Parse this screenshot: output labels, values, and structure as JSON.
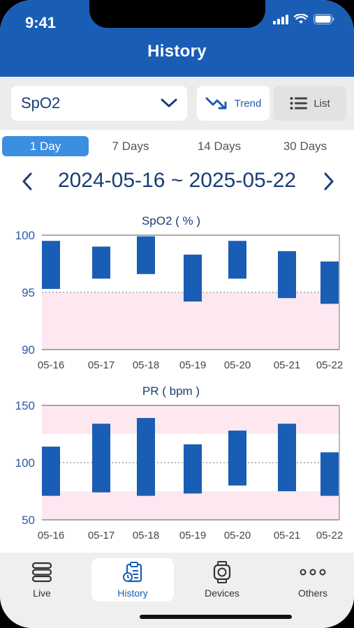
{
  "status": {
    "time": "9:41"
  },
  "header": {
    "title": "History"
  },
  "controls": {
    "metric_select": {
      "value": "SpO2"
    },
    "trend_label": "Trend",
    "list_label": "List"
  },
  "range_tabs": [
    {
      "label": "1 Day",
      "active": true
    },
    {
      "label": "7 Days",
      "active": false
    },
    {
      "label": "14 Days",
      "active": false
    },
    {
      "label": "30 Days",
      "active": false
    }
  ],
  "date_range": "2024-05-16 ~ 2025-05-22",
  "chart_data": [
    {
      "type": "bar",
      "title": "SpO2 ( % )",
      "categories": [
        "05-16",
        "05-17",
        "05-18",
        "05-19",
        "05-20",
        "05-21",
        "05-22"
      ],
      "series": [
        {
          "low": [
            95.3,
            96.2,
            96.6,
            94.2,
            96.2,
            94.5,
            94.0
          ],
          "high": [
            99.5,
            99.0,
            99.9,
            98.3,
            99.5,
            98.6,
            97.7
          ]
        }
      ],
      "ylim": [
        90,
        100
      ],
      "yticks": [
        90,
        95,
        100
      ],
      "normal_band": [
        90,
        95
      ],
      "reference_line": 95,
      "colors": {
        "bar": "#1a5db5",
        "band": "#fde8f1",
        "text": "#1a3c78"
      }
    },
    {
      "type": "bar",
      "title": "PR ( bpm )",
      "categories": [
        "05-16",
        "05-17",
        "05-18",
        "05-19",
        "05-20",
        "05-21",
        "05-22"
      ],
      "series": [
        {
          "low": [
            71,
            74,
            71,
            73,
            80,
            75,
            71
          ],
          "high": [
            114,
            134,
            139,
            116,
            128,
            134,
            109
          ]
        }
      ],
      "ylim": [
        50,
        150
      ],
      "yticks": [
        50,
        100,
        150
      ],
      "bands": [
        [
          125,
          150
        ],
        [
          50,
          75
        ]
      ],
      "reference_line": 100,
      "colors": {
        "bar": "#1a5db5",
        "band": "#fde8f1",
        "text": "#1a3c78"
      }
    }
  ],
  "tabbar": [
    {
      "label": "Live",
      "icon": "stack-icon",
      "active": false
    },
    {
      "label": "History",
      "icon": "clipboard-clock-icon",
      "active": true
    },
    {
      "label": "Devices",
      "icon": "watch-icon",
      "active": false
    },
    {
      "label": "Others",
      "icon": "more-dots-icon",
      "active": false
    }
  ]
}
